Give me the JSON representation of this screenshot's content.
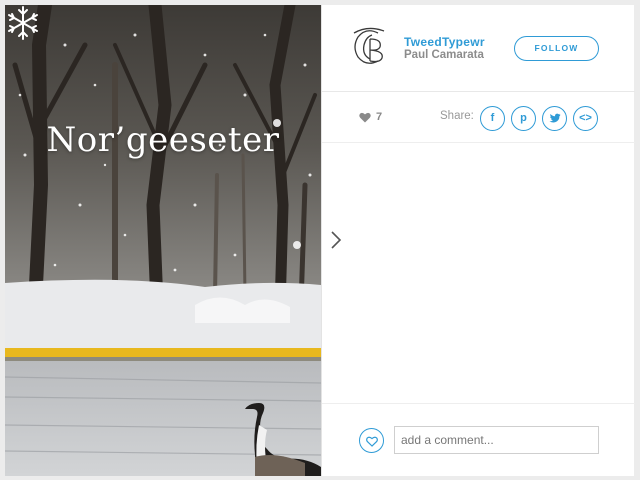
{
  "photo": {
    "title": "Nor’geeseter",
    "icon": "snowflake-icon"
  },
  "profile": {
    "username": "TweedTypewr",
    "real_name": "Paul Camarata",
    "follow_label": "FOLLOW",
    "avatar_icon": "monogram-avatar"
  },
  "stats": {
    "like_count": "7",
    "share_label": "Share:",
    "share_buttons": [
      {
        "name": "facebook",
        "glyph": "f"
      },
      {
        "name": "pinterest",
        "glyph": "p"
      },
      {
        "name": "twitter",
        "glyph": "twitter-bird-icon"
      },
      {
        "name": "embed",
        "glyph": "<>"
      }
    ]
  },
  "comment": {
    "placeholder": "add a comment..."
  },
  "colors": {
    "accent": "#2f9bd6",
    "muted_text": "#8c8c8c",
    "road_line": "#e8b81e"
  }
}
